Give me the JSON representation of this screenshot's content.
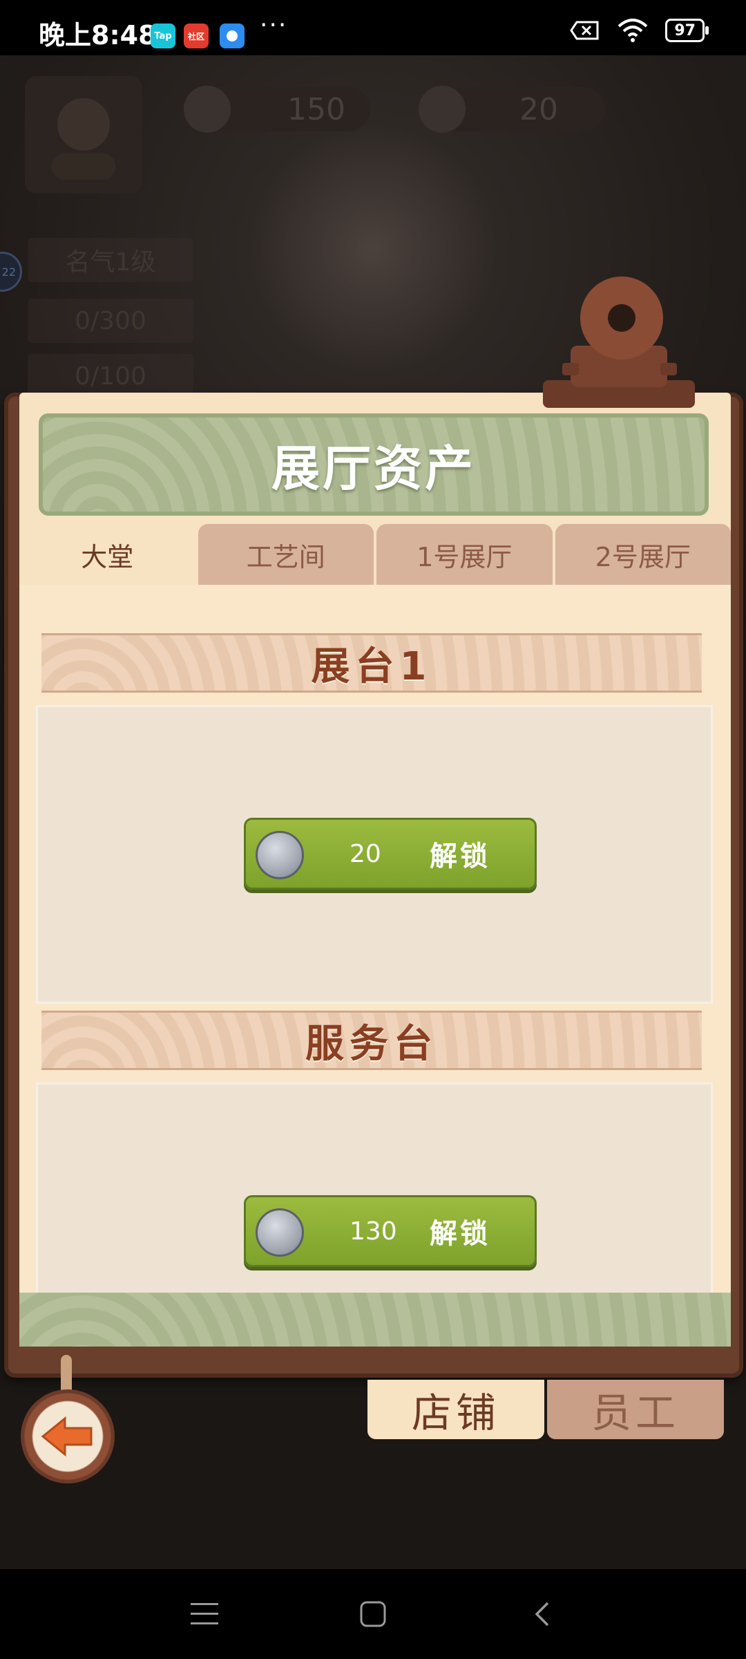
{
  "status_bar": {
    "time": "晚上8:48",
    "apps": [
      {
        "name": "tap-icon",
        "label": "Tap",
        "color": "#18c5d8"
      },
      {
        "name": "shequ-icon",
        "label": "社区",
        "color": "#e43b2f"
      },
      {
        "name": "chat-icon",
        "label": "",
        "color": "#2d8cf0"
      }
    ],
    "more": "···",
    "battery": "97"
  },
  "background_hud": {
    "coins": "150",
    "gems": "20",
    "fame_label": "名气1级",
    "progress_1": "0/300",
    "progress_2": "0/100",
    "badge": "22"
  },
  "panel": {
    "title": "展厅资产",
    "tabs": [
      {
        "label": "大堂",
        "active": true
      },
      {
        "label": "工艺间",
        "active": false
      },
      {
        "label": "1号展厅",
        "active": false
      },
      {
        "label": "2号展厅",
        "active": false
      }
    ],
    "sections": [
      {
        "title": "展台1",
        "price": "20",
        "action": "解锁"
      },
      {
        "title": "服务台",
        "price": "130",
        "action": "解锁"
      }
    ]
  },
  "bottom_tabs": [
    {
      "label": "店铺",
      "active": true
    },
    {
      "label": "员工",
      "active": false
    }
  ],
  "colors": {
    "accent_green": "#8fb036",
    "paper": "#f7e2c2",
    "wood": "#6a3f2b",
    "title_brown": "#8a3f22"
  }
}
